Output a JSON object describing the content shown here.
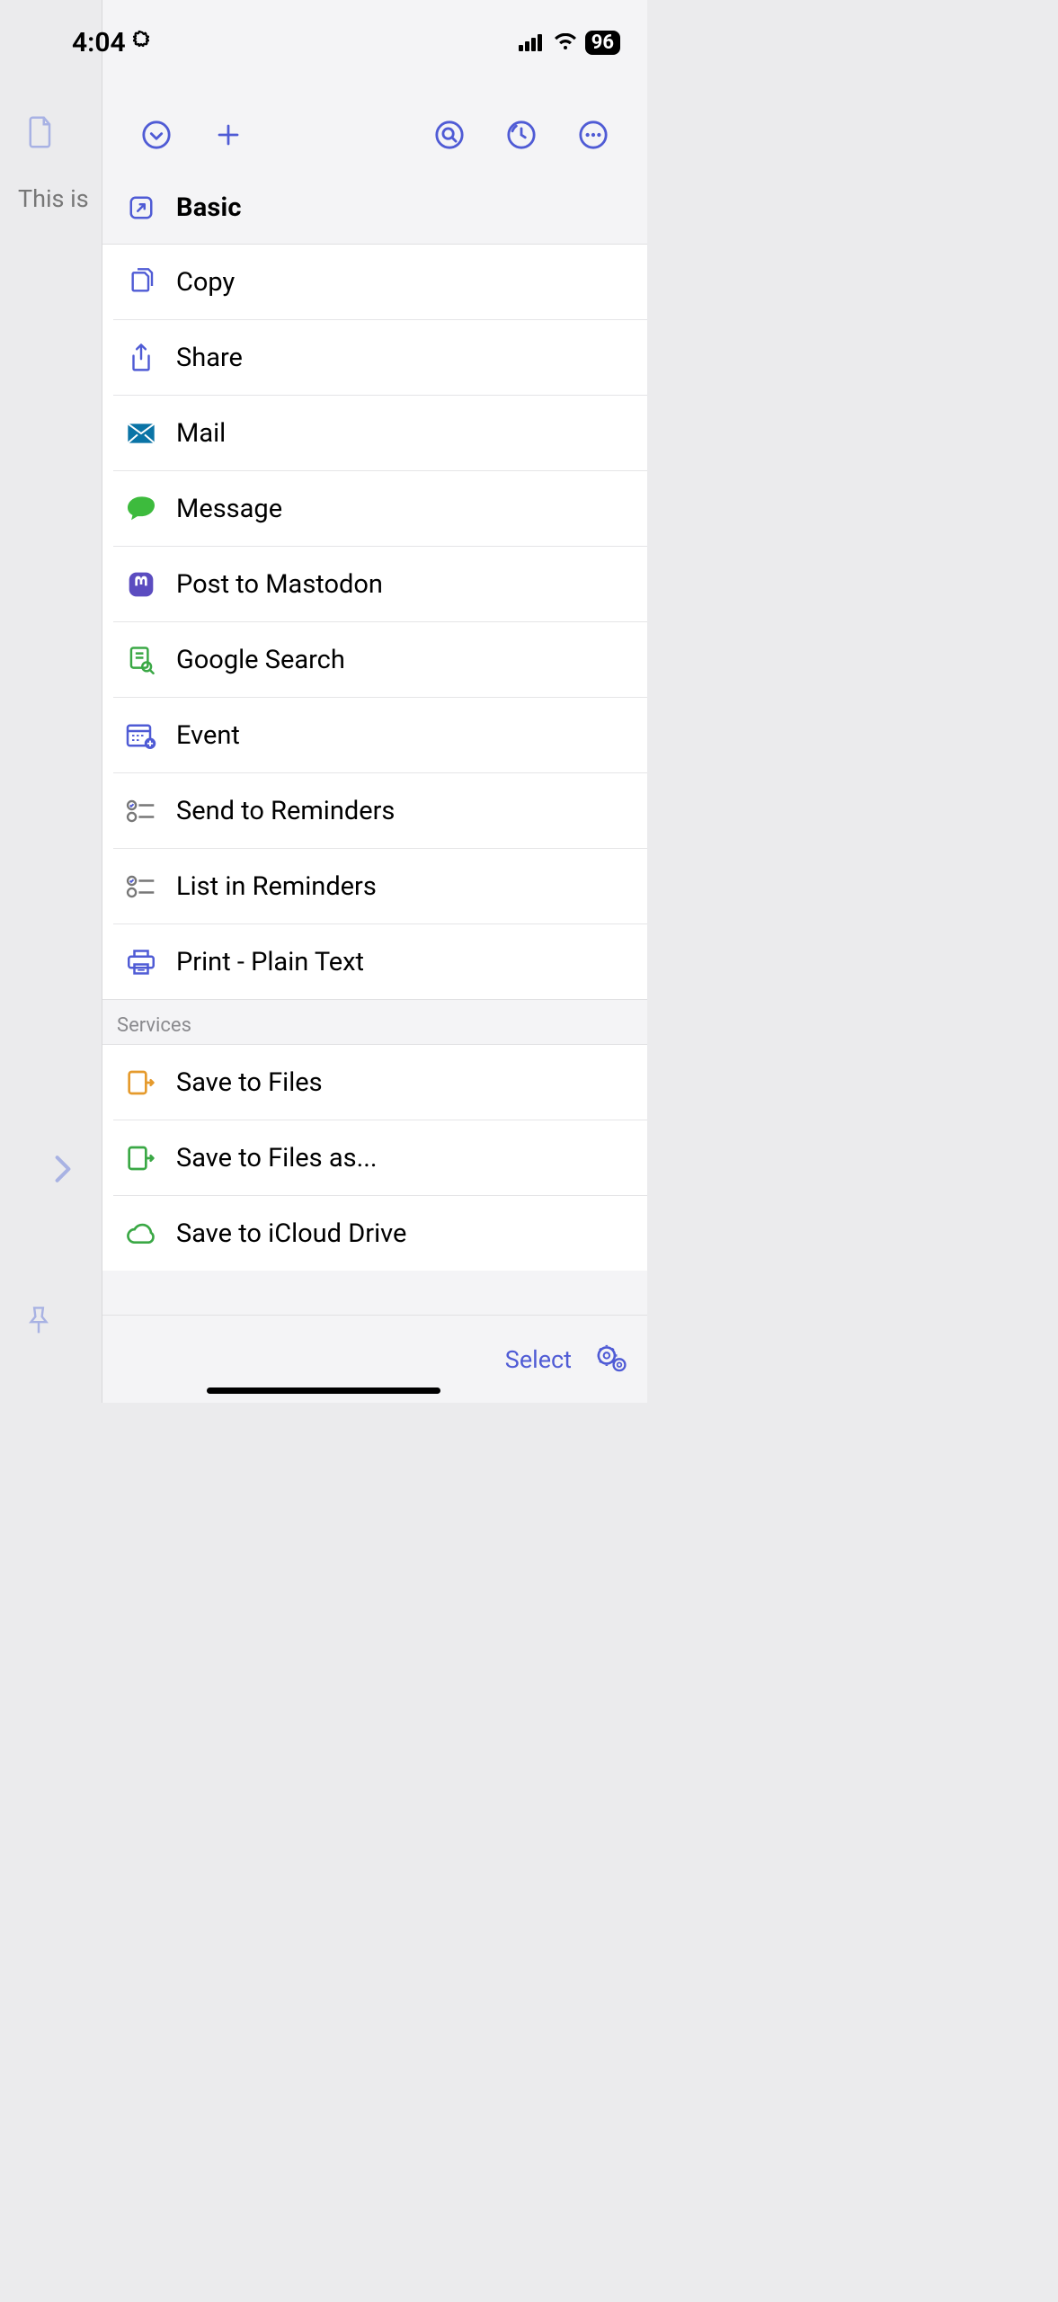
{
  "status": {
    "time": "4:04",
    "battery": "96"
  },
  "background": {
    "doc_preview_text": "This is"
  },
  "panel": {
    "header": {
      "title": "Basic"
    },
    "sections": {
      "main": [
        {
          "label": "Copy",
          "icon": "copy"
        },
        {
          "label": "Share",
          "icon": "share"
        },
        {
          "label": "Mail",
          "icon": "mail"
        },
        {
          "label": "Message",
          "icon": "message"
        },
        {
          "label": "Post to Mastodon",
          "icon": "mastodon"
        },
        {
          "label": "Google Search",
          "icon": "search-doc"
        },
        {
          "label": "Event",
          "icon": "calendar"
        },
        {
          "label": "Send to Reminders",
          "icon": "reminders"
        },
        {
          "label": "List in Reminders",
          "icon": "reminders"
        },
        {
          "label": "Print - Plain Text",
          "icon": "print"
        }
      ],
      "services_label": "Services",
      "services": [
        {
          "label": "Save to Files",
          "icon": "save-orange"
        },
        {
          "label": "Save to Files as...",
          "icon": "save-green"
        },
        {
          "label": "Save to iCloud Drive",
          "icon": "cloud"
        }
      ]
    },
    "bottom": {
      "select": "Select"
    }
  }
}
